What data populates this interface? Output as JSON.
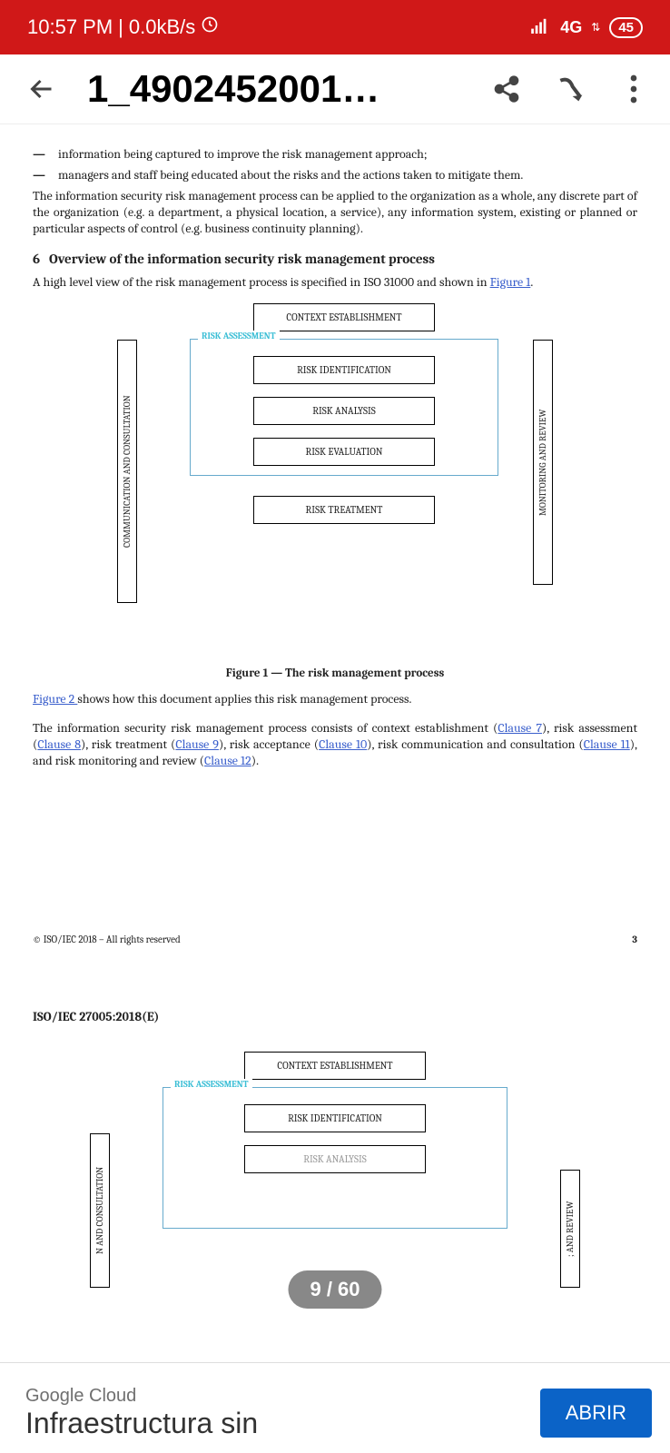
{
  "status": {
    "time": "10:57 PM",
    "sep": " | ",
    "speed": "0.0kB/s",
    "network": "4G",
    "battery": "45"
  },
  "header": {
    "title": "1_4902452001…"
  },
  "doc": {
    "bullets": [
      "information being captured to improve the risk management approach;",
      "managers and staff being educated about the risks and the actions taken to mitigate them."
    ],
    "para1": "The information security risk management process can be applied to the organization as a whole, any discrete part of the organization (e.g. a department, a physical location, a service), any information system, existing or planned or particular aspects of control (e.g. business continuity planning).",
    "section_num": "6",
    "section_title": "Overview of the information security risk management process",
    "para2a": "A high level view of the risk management process is specified in ISO 31000 and shown in ",
    "fig1_link": "Figure 1",
    "diagram": {
      "left": "COMMUNICATION AND CONSULTATION",
      "right": "MONITORING AND REVIEW",
      "context": "CONTEXT ESTABLISHMENT",
      "ra": "RISK ASSESSMENT",
      "ident": "RISK IDENTIFICATION",
      "analysis": "RISK ANALYSIS",
      "eval": "RISK EVALUATION",
      "treat": "RISK TREATMENT"
    },
    "fig_caption": "Figure 1 — The risk management process",
    "fig2_link": "Figure 2 ",
    "para3a": "shows how this document applies this risk management process.",
    "para4a": "The information security risk management process consists of context establishment (",
    "c7": "Clause 7",
    "p4b": "), risk assessment (",
    "c8": "Clause 8",
    "p4c": "), risk treatment (",
    "c9": "Clause 9",
    "p4d": "), risk acceptance (",
    "c10": "Clause 10",
    "p4e": "), risk communication and consultation (",
    "c11": "Clause 11",
    "p4f": "), and risk monitoring and review (",
    "c12": "Clause 12",
    "p4g": ").",
    "copyright": "© ISO/IEC 2018 – All rights reserved",
    "page_num": "3",
    "next_hdr": "ISO/IEC 27005:2018(E)",
    "d2": {
      "left": "N AND CONSULTATION",
      "right": "; AND REVIEW",
      "context": "CONTEXT ESTABLISHMENT",
      "ra": "RISK ASSESSMENT",
      "ident": "RISK IDENTIFICATION",
      "analysis": "RISK ANALYSIS"
    }
  },
  "page_indicator": "9 / 60",
  "ad": {
    "brand": "Google Cloud",
    "title": "Infraestructura sin",
    "button": "ABRIR"
  }
}
